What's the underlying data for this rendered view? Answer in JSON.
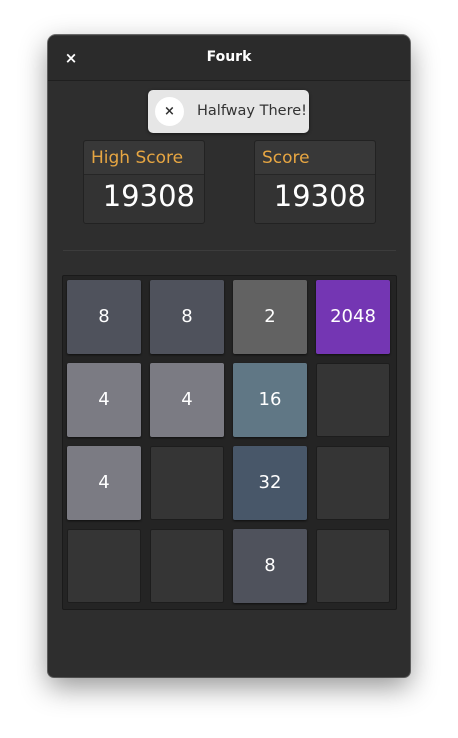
{
  "window": {
    "title": "Fourk",
    "close_glyph": "×"
  },
  "toast": {
    "close_glyph": "×",
    "message": "Halfway There!"
  },
  "scores": {
    "high_score_label": "High Score",
    "high_score_value": "19308",
    "score_label": "Score",
    "score_value": "19308"
  },
  "board": {
    "grid": [
      [
        8,
        8,
        2,
        2048
      ],
      [
        4,
        4,
        16,
        null
      ],
      [
        4,
        null,
        32,
        null
      ],
      [
        null,
        null,
        8,
        null
      ]
    ],
    "tile_colors": {
      "2": "#626262",
      "4": "#7b7b83",
      "8": "#4f525c",
      "16": "#607785",
      "32": "#485769",
      "2048": "#7436b3"
    }
  },
  "colors": {
    "score_label": "#e7a642",
    "window_bg": "#2e2e2e"
  }
}
